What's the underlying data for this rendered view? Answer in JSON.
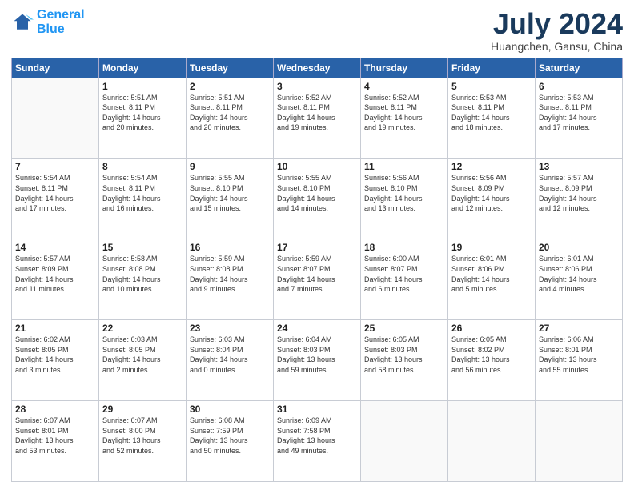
{
  "header": {
    "logo_line1": "General",
    "logo_line2": "Blue",
    "title": "July 2024",
    "subtitle": "Huangchen, Gansu, China"
  },
  "weekdays": [
    "Sunday",
    "Monday",
    "Tuesday",
    "Wednesday",
    "Thursday",
    "Friday",
    "Saturday"
  ],
  "weeks": [
    [
      {
        "day": "",
        "info": ""
      },
      {
        "day": "1",
        "info": "Sunrise: 5:51 AM\nSunset: 8:11 PM\nDaylight: 14 hours\nand 20 minutes."
      },
      {
        "day": "2",
        "info": "Sunrise: 5:51 AM\nSunset: 8:11 PM\nDaylight: 14 hours\nand 20 minutes."
      },
      {
        "day": "3",
        "info": "Sunrise: 5:52 AM\nSunset: 8:11 PM\nDaylight: 14 hours\nand 19 minutes."
      },
      {
        "day": "4",
        "info": "Sunrise: 5:52 AM\nSunset: 8:11 PM\nDaylight: 14 hours\nand 19 minutes."
      },
      {
        "day": "5",
        "info": "Sunrise: 5:53 AM\nSunset: 8:11 PM\nDaylight: 14 hours\nand 18 minutes."
      },
      {
        "day": "6",
        "info": "Sunrise: 5:53 AM\nSunset: 8:11 PM\nDaylight: 14 hours\nand 17 minutes."
      }
    ],
    [
      {
        "day": "7",
        "info": "Sunrise: 5:54 AM\nSunset: 8:11 PM\nDaylight: 14 hours\nand 17 minutes."
      },
      {
        "day": "8",
        "info": "Sunrise: 5:54 AM\nSunset: 8:11 PM\nDaylight: 14 hours\nand 16 minutes."
      },
      {
        "day": "9",
        "info": "Sunrise: 5:55 AM\nSunset: 8:10 PM\nDaylight: 14 hours\nand 15 minutes."
      },
      {
        "day": "10",
        "info": "Sunrise: 5:55 AM\nSunset: 8:10 PM\nDaylight: 14 hours\nand 14 minutes."
      },
      {
        "day": "11",
        "info": "Sunrise: 5:56 AM\nSunset: 8:10 PM\nDaylight: 14 hours\nand 13 minutes."
      },
      {
        "day": "12",
        "info": "Sunrise: 5:56 AM\nSunset: 8:09 PM\nDaylight: 14 hours\nand 12 minutes."
      },
      {
        "day": "13",
        "info": "Sunrise: 5:57 AM\nSunset: 8:09 PM\nDaylight: 14 hours\nand 12 minutes."
      }
    ],
    [
      {
        "day": "14",
        "info": "Sunrise: 5:57 AM\nSunset: 8:09 PM\nDaylight: 14 hours\nand 11 minutes."
      },
      {
        "day": "15",
        "info": "Sunrise: 5:58 AM\nSunset: 8:08 PM\nDaylight: 14 hours\nand 10 minutes."
      },
      {
        "day": "16",
        "info": "Sunrise: 5:59 AM\nSunset: 8:08 PM\nDaylight: 14 hours\nand 9 minutes."
      },
      {
        "day": "17",
        "info": "Sunrise: 5:59 AM\nSunset: 8:07 PM\nDaylight: 14 hours\nand 7 minutes."
      },
      {
        "day": "18",
        "info": "Sunrise: 6:00 AM\nSunset: 8:07 PM\nDaylight: 14 hours\nand 6 minutes."
      },
      {
        "day": "19",
        "info": "Sunrise: 6:01 AM\nSunset: 8:06 PM\nDaylight: 14 hours\nand 5 minutes."
      },
      {
        "day": "20",
        "info": "Sunrise: 6:01 AM\nSunset: 8:06 PM\nDaylight: 14 hours\nand 4 minutes."
      }
    ],
    [
      {
        "day": "21",
        "info": "Sunrise: 6:02 AM\nSunset: 8:05 PM\nDaylight: 14 hours\nand 3 minutes."
      },
      {
        "day": "22",
        "info": "Sunrise: 6:03 AM\nSunset: 8:05 PM\nDaylight: 14 hours\nand 2 minutes."
      },
      {
        "day": "23",
        "info": "Sunrise: 6:03 AM\nSunset: 8:04 PM\nDaylight: 14 hours\nand 0 minutes."
      },
      {
        "day": "24",
        "info": "Sunrise: 6:04 AM\nSunset: 8:03 PM\nDaylight: 13 hours\nand 59 minutes."
      },
      {
        "day": "25",
        "info": "Sunrise: 6:05 AM\nSunset: 8:03 PM\nDaylight: 13 hours\nand 58 minutes."
      },
      {
        "day": "26",
        "info": "Sunrise: 6:05 AM\nSunset: 8:02 PM\nDaylight: 13 hours\nand 56 minutes."
      },
      {
        "day": "27",
        "info": "Sunrise: 6:06 AM\nSunset: 8:01 PM\nDaylight: 13 hours\nand 55 minutes."
      }
    ],
    [
      {
        "day": "28",
        "info": "Sunrise: 6:07 AM\nSunset: 8:01 PM\nDaylight: 13 hours\nand 53 minutes."
      },
      {
        "day": "29",
        "info": "Sunrise: 6:07 AM\nSunset: 8:00 PM\nDaylight: 13 hours\nand 52 minutes."
      },
      {
        "day": "30",
        "info": "Sunrise: 6:08 AM\nSunset: 7:59 PM\nDaylight: 13 hours\nand 50 minutes."
      },
      {
        "day": "31",
        "info": "Sunrise: 6:09 AM\nSunset: 7:58 PM\nDaylight: 13 hours\nand 49 minutes."
      },
      {
        "day": "",
        "info": ""
      },
      {
        "day": "",
        "info": ""
      },
      {
        "day": "",
        "info": ""
      }
    ]
  ]
}
